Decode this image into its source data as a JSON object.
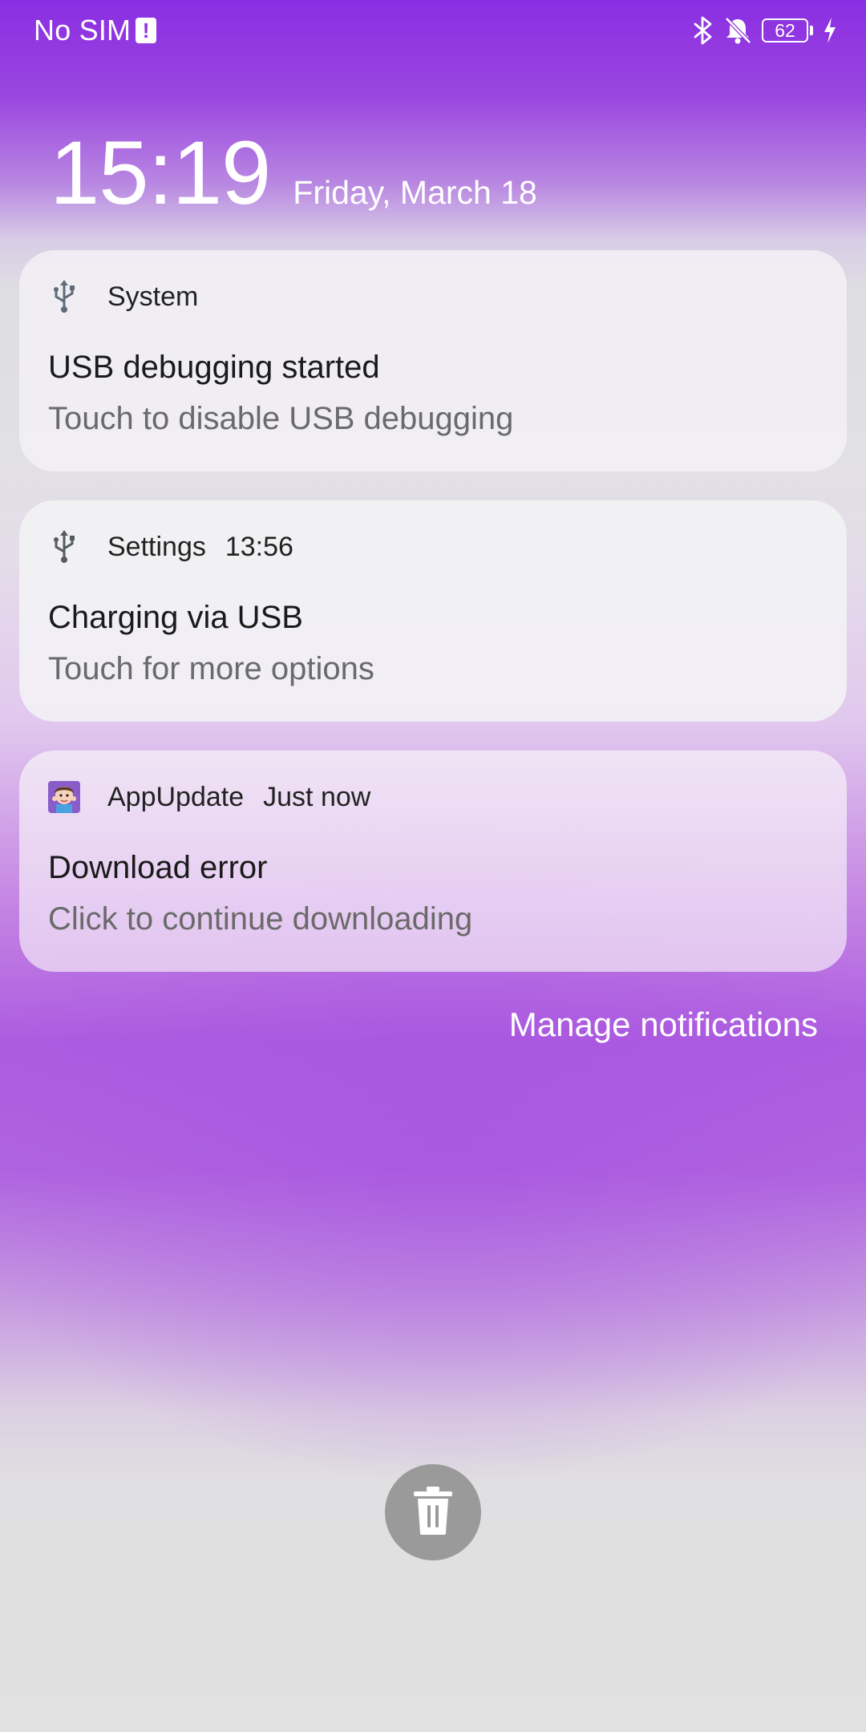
{
  "status_bar": {
    "carrier": "No SIM",
    "sim_alert_icon": "sim-alert-icon",
    "battery_level": "62",
    "icons": [
      "bluetooth-icon",
      "notifications-muted-icon",
      "battery-icon",
      "charging-bolt-icon"
    ]
  },
  "lockscreen": {
    "time": "15:19",
    "date": "Friday, March 18"
  },
  "notifications": [
    {
      "app": "System",
      "time": "",
      "icon": "usb-icon",
      "title": "USB debugging started",
      "body": "Touch to disable USB debugging"
    },
    {
      "app": "Settings",
      "time": "13:56",
      "icon": "usb-icon",
      "title": "Charging via USB",
      "body": "Touch for more options"
    },
    {
      "app": "AppUpdate",
      "time": "Just now",
      "icon": "app-update-avatar-icon",
      "title": "Download error",
      "body": "Click to continue downloading"
    }
  ],
  "manage_notifications_label": "Manage notifications",
  "clear_button_icon": "trash-icon",
  "colors": {
    "background_top": "#8a2ee2",
    "background_bottom": "#e1e1e1",
    "card_text": "#1a1a1a",
    "card_subtext": "#6a6a6a",
    "trash_button": "#9a9a9a"
  }
}
